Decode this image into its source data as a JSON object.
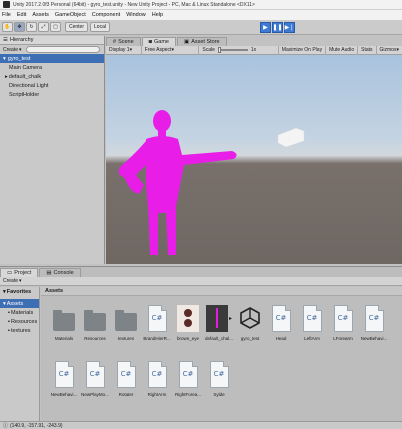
{
  "window": {
    "title": "Unity 2017.2.0f3 Personal (64bit) - gyro_test.unity - New Unity Project - PC, Mac & Linux Standalone <DX11>"
  },
  "menu": [
    "File",
    "Edit",
    "Assets",
    "GameObject",
    "Component",
    "Window",
    "Help"
  ],
  "toolbar": {
    "pivot_label": "Center",
    "space_label": "Local",
    "play_icon": "play-icon",
    "pause_icon": "pause-icon",
    "step_icon": "step-icon"
  },
  "hierarchy": {
    "tab_label": "Hierarchy",
    "create_label": "Create",
    "search_prefix": "Q•All",
    "scene_name": "gyro_test",
    "items": [
      "Main Camera",
      "default_chalk",
      "Directional Light",
      "ScriptHolder"
    ]
  },
  "game": {
    "tabs": [
      "Scene",
      "Game",
      "Asset Store"
    ],
    "display": "Display 1",
    "aspect": "Free Aspect",
    "scale_label": "Scale",
    "scale_value": "1x",
    "options": [
      "Maximize On Play",
      "Mute Audio",
      "Stats",
      "Gizmos"
    ]
  },
  "project": {
    "tabs": [
      "Project",
      "Console"
    ],
    "create_label": "Create",
    "left_items": [
      "Favorites",
      "Assets",
      "Materials",
      "Resources",
      "textures"
    ],
    "breadcrumb": "Assets",
    "assets_row1": [
      "Materials",
      "Resources",
      "textures",
      "BrandHierR...",
      "brown_eye",
      "default_chal...",
      "gyro_test",
      "Head",
      "LeftArm",
      "LForearm",
      "NewBehavi..."
    ],
    "assets_row2": [
      "NewBehavi...",
      "NewPlayMo...",
      "Rotater",
      "RightArm",
      "RightForea...",
      "Sylde"
    ]
  },
  "status": {
    "text": "(140.9, -157.91, -243.9)"
  },
  "colors": {
    "magenta": "#e81de8",
    "selection": "#3e6fb5",
    "play_blue": "#3e7ad6"
  }
}
